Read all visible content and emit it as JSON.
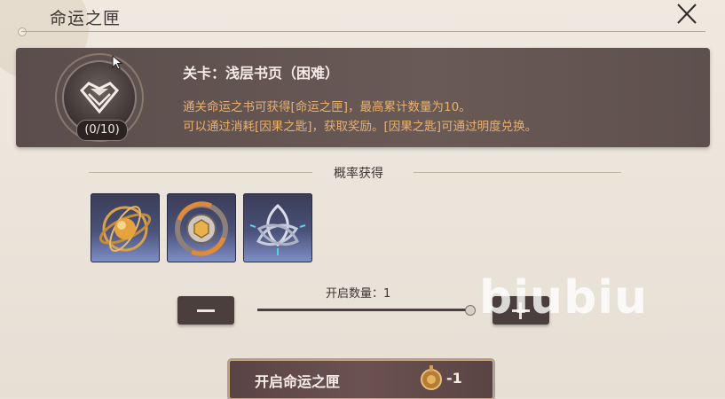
{
  "window": {
    "title": "命运之匣",
    "close_icon": "close-icon"
  },
  "banner": {
    "badge_icon": "heart-gem-icon",
    "count": "(0/10)",
    "stage_label": "关卡：浅层书页（困难）",
    "description_lines": [
      "通关命运之书可获得[命运之匣]，最高累计数量为10。",
      "可以通过消耗[因果之匙]，获取奖励。[因果之匙]可通过明度兑换。"
    ]
  },
  "probability": {
    "header": "概率获得",
    "items": [
      {
        "icon": "golden-orb-icon"
      },
      {
        "icon": "coin-cycle-icon"
      },
      {
        "icon": "crystal-knot-icon"
      }
    ]
  },
  "quantity": {
    "label": "开启数量：1",
    "value": 1,
    "minus_icon": "minus-icon",
    "plus_icon": "plus-icon"
  },
  "watermark": "biubiu",
  "open_button": {
    "label": "开启命运之匣",
    "cost": "-1",
    "cost_icon": "key-coin-icon"
  },
  "colors": {
    "background": "#e9e2d8",
    "banner": "#5e504d",
    "accent_text": "#e9b06e",
    "item_slot": "#4b527a"
  }
}
